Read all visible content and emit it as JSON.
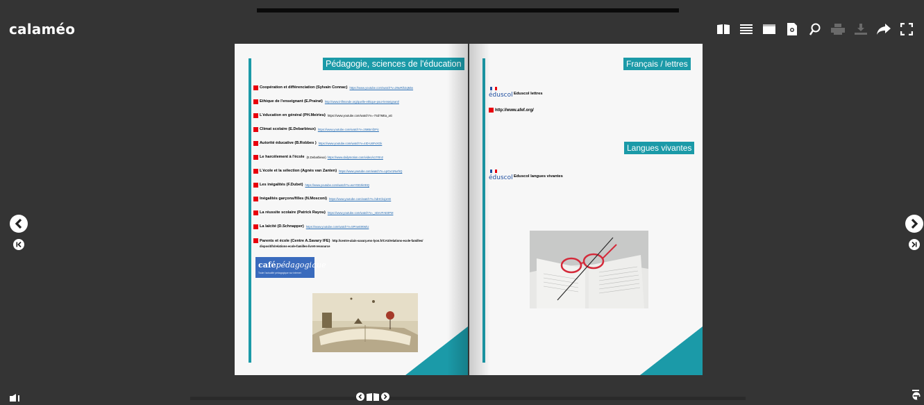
{
  "app": {
    "logo_text": "calaméo"
  },
  "toolbar": {
    "buttons": [
      {
        "icon": "book-icon"
      },
      {
        "icon": "list-icon"
      },
      {
        "icon": "single-page-icon"
      },
      {
        "icon": "document-icon"
      },
      {
        "icon": "zoom-icon"
      },
      {
        "icon": "print-icon"
      },
      {
        "icon": "download-icon"
      },
      {
        "icon": "share-icon"
      },
      {
        "icon": "fullscreen-icon"
      }
    ]
  },
  "left_page": {
    "heading": "Pédagogie, sciences de l'éducation",
    "entries": [
      {
        "title": "Coopération et différenciation (Sylvain Connac)",
        "link": "https://www.youtube.com/watch?v=29wRih2qMiw"
      },
      {
        "title": "Ethique de l'enseignant (E.Prairat)",
        "link": "http://www.inflmonde.org/quelle-ethique-pour-lenseignant/"
      },
      {
        "title": "L'éducation en général (PH.Meirieu)",
        "link": "https://www.youtube.com/watch?v=-7Sd7MEa_aG"
      },
      {
        "title": "Climat scolaire (E.Debarbieux)",
        "link": "https://www.youtube.com/watch?v=2IMBmf2Pic"
      },
      {
        "title": "Autorité éducative (B.Robbes )",
        "link": "https://www.youtube.com/watch?v=4ID-U6FvXGk"
      },
      {
        "title": "Le harcèlement à l'école",
        "note": "(E.Debarbieux)",
        "link": "https://www.dailymotion.com/video/x17r0n2"
      },
      {
        "title": "L'école et la sélection (Agnès van Zanten)",
        "link": "https://www.youtube.com/watch?v=LpGxr1NvrhQ"
      },
      {
        "title": "Les inégalités (F.Dubet)",
        "link": "https://www.youtube.com/watch?v=wvYODzk0DQ"
      },
      {
        "title": "Inégalités garçons/filles (N.Mosconi)",
        "link": "https://www.youtube.com/watch?v=hdHCkxjxHE"
      },
      {
        "title": "La réussite scolaire (Patrick Rayou)",
        "link": "https://www.youtube.com/watch?v=_nDvVFAE0PM"
      },
      {
        "title": "La laïcité (D.Schnapper)",
        "link": "https://www.youtube.com/watch?v=5PmeE9tWiU"
      }
    ],
    "last_entry": {
      "title": "Parents et école (Centre A.Savary IFE)",
      "link_line1": "http://centre-alain-savary.ens-lyon.fr/CAS/relations-ecole-familles/",
      "link_line2": "dispositifs/relations-ecole-familles-livret-ressource"
    },
    "cafe_logo": {
      "word1": "café",
      "word2": "pédagogique",
      "tagline": "Toute l'actualité pédagogique sur internet"
    }
  },
  "right_page": {
    "heading1": "Français / lettres",
    "heading2": "Langues vivantes",
    "eduscol_word": "éduscol",
    "eduscol_label1": "Eduscol lettres",
    "url_text": "http://www.afef.org/",
    "eduscol_label2": "Eduscol langues vivantes"
  },
  "colors": {
    "accent": "#1b9aa8",
    "bullet": "#e8000d",
    "background": "#343434"
  }
}
